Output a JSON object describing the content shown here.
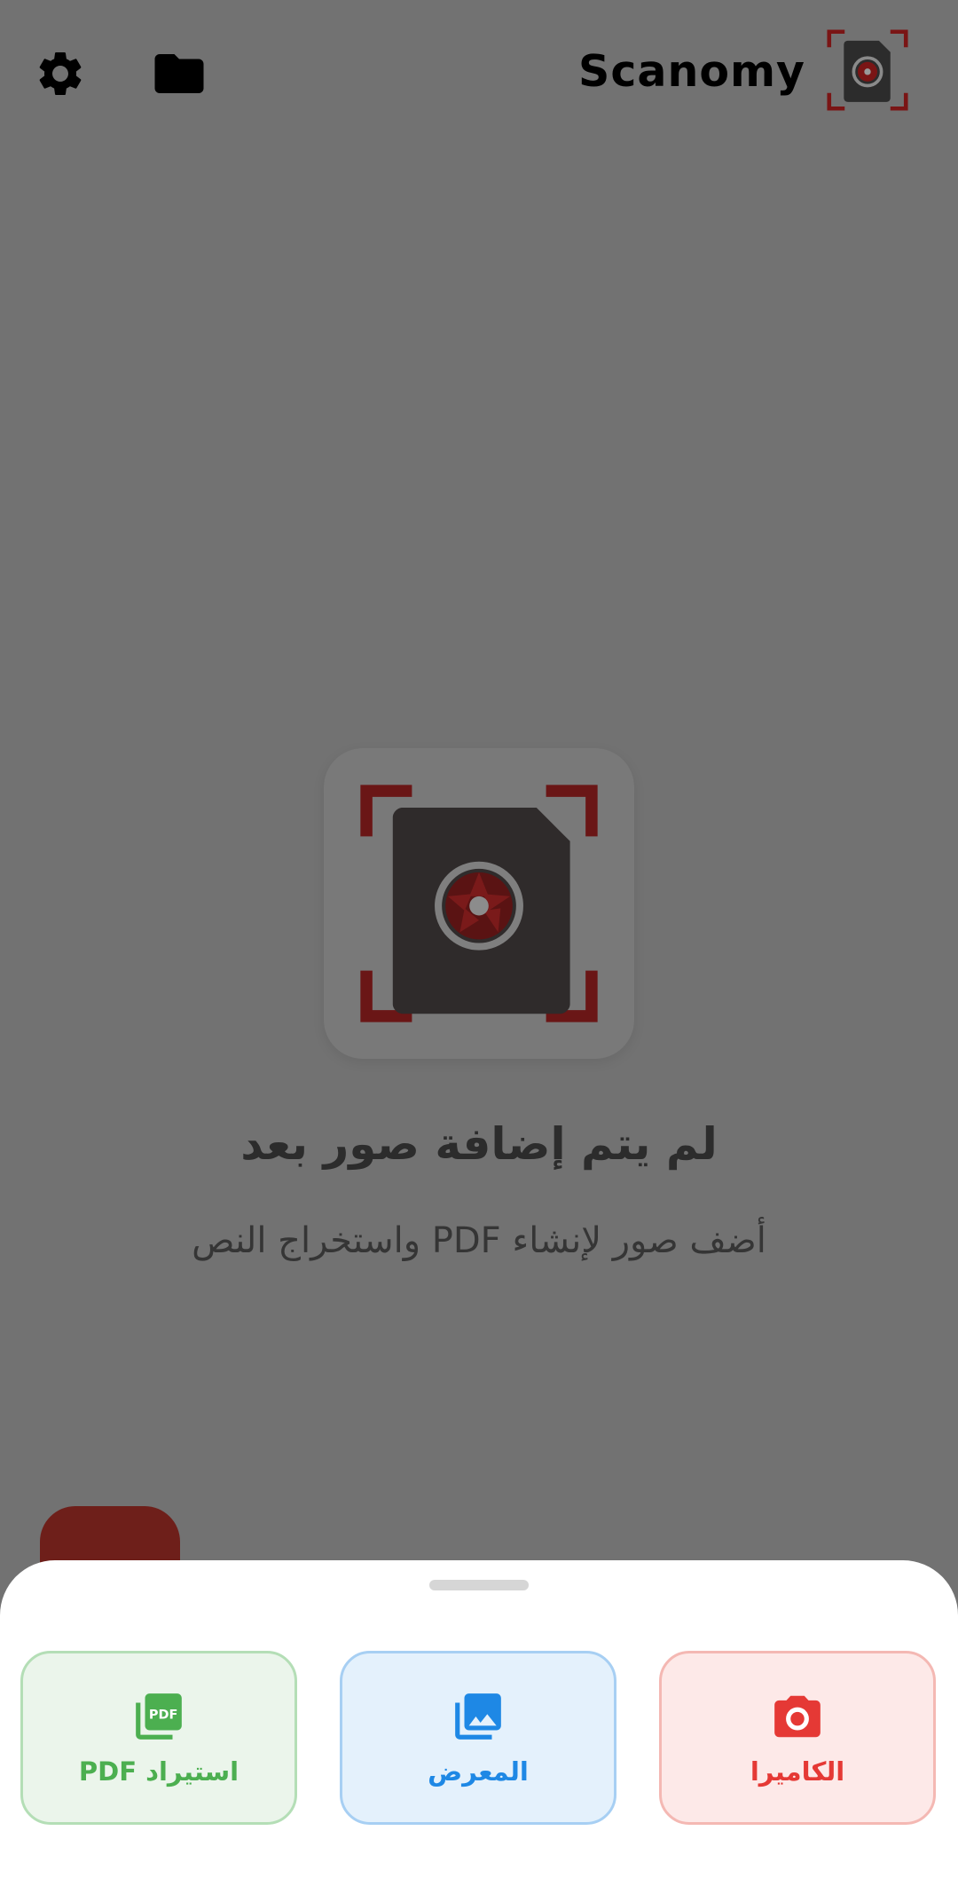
{
  "app_bar": {
    "title": "Scanomy",
    "settings_icon": "gear-icon",
    "folder_icon": "folder-icon",
    "logo_icon": "scanner-logo-icon"
  },
  "empty_state": {
    "title": "لم يتم إضافة صور بعد",
    "subtitle": "أضف صور لإنشاء PDF واستخراج النص"
  },
  "bottom_sheet": {
    "actions": [
      {
        "label": "استيراد PDF",
        "icon": "pdf-icon",
        "color": "#4caf50"
      },
      {
        "label": "المعرض",
        "icon": "photo-library-icon",
        "color": "#1e88e5"
      },
      {
        "label": "الكاميرا",
        "icon": "camera-icon",
        "color": "#e53935"
      }
    ]
  },
  "colors": {
    "brand_red": "#8a1c1c",
    "scrim": "#727272",
    "fab": "#6e1f1a"
  }
}
